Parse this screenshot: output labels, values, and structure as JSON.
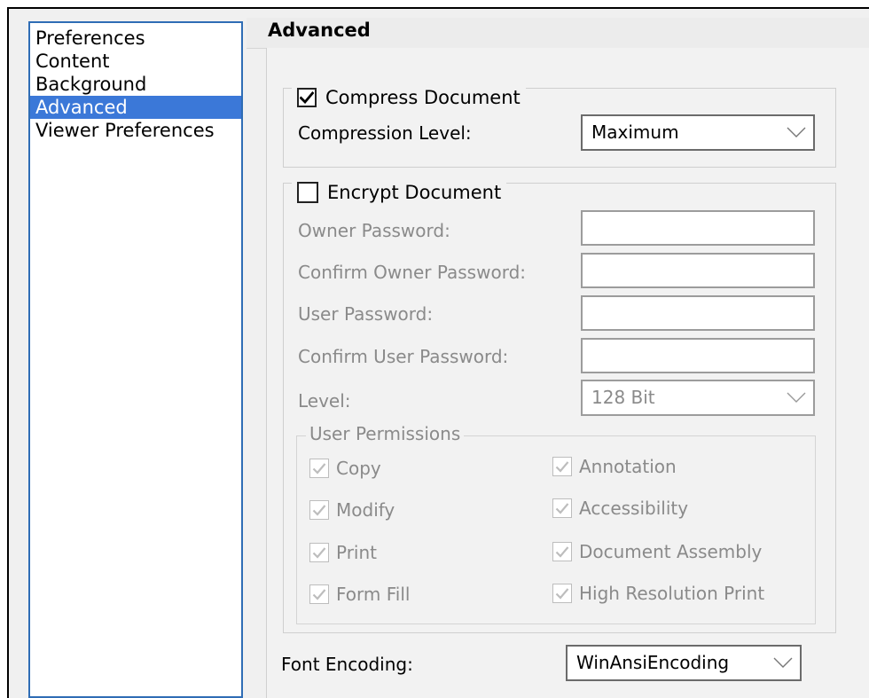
{
  "sidebar": {
    "items": [
      {
        "label": "Preferences"
      },
      {
        "label": "Content"
      },
      {
        "label": "Background"
      },
      {
        "label": "Advanced",
        "selected": true
      },
      {
        "label": "Viewer Preferences"
      }
    ]
  },
  "panel": {
    "title": "Advanced"
  },
  "compress": {
    "checkbox_label": "Compress Document",
    "checked": true,
    "level_label": "Compression Level:",
    "level_value": "Maximum"
  },
  "encrypt": {
    "checkbox_label": "Encrypt Document",
    "checked": false,
    "owner_password_label": "Owner Password:",
    "confirm_owner_password_label": "Confirm Owner Password:",
    "user_password_label": "User Password:",
    "confirm_user_password_label": "Confirm User Password:",
    "level_label": "Level:",
    "level_value": "128 Bit",
    "permissions": {
      "title": "User Permissions",
      "items": [
        {
          "label": "Copy",
          "checked": true
        },
        {
          "label": "Annotation",
          "checked": true
        },
        {
          "label": "Modify",
          "checked": true
        },
        {
          "label": "Accessibility",
          "checked": true
        },
        {
          "label": "Print",
          "checked": true
        },
        {
          "label": "Document Assembly",
          "checked": true
        },
        {
          "label": "Form Fill",
          "checked": true
        },
        {
          "label": "High Resolution Print",
          "checked": true
        }
      ]
    }
  },
  "font_encoding": {
    "label": "Font Encoding:",
    "value": "WinAnsiEncoding"
  },
  "icons": {
    "check": "checkmark-icon",
    "dropdown": "chevron-down-icon"
  }
}
